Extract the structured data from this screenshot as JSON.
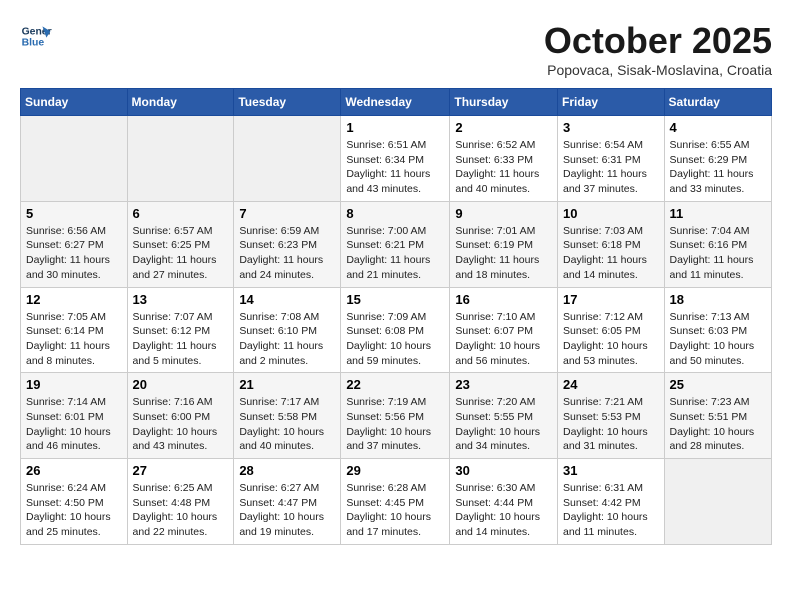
{
  "header": {
    "logo_line1": "General",
    "logo_line2": "Blue",
    "month": "October 2025",
    "location": "Popovaca, Sisak-Moslavina, Croatia"
  },
  "weekdays": [
    "Sunday",
    "Monday",
    "Tuesday",
    "Wednesday",
    "Thursday",
    "Friday",
    "Saturday"
  ],
  "weeks": [
    [
      {
        "day": "",
        "info": ""
      },
      {
        "day": "",
        "info": ""
      },
      {
        "day": "",
        "info": ""
      },
      {
        "day": "1",
        "info": "Sunrise: 6:51 AM\nSunset: 6:34 PM\nDaylight: 11 hours\nand 43 minutes."
      },
      {
        "day": "2",
        "info": "Sunrise: 6:52 AM\nSunset: 6:33 PM\nDaylight: 11 hours\nand 40 minutes."
      },
      {
        "day": "3",
        "info": "Sunrise: 6:54 AM\nSunset: 6:31 PM\nDaylight: 11 hours\nand 37 minutes."
      },
      {
        "day": "4",
        "info": "Sunrise: 6:55 AM\nSunset: 6:29 PM\nDaylight: 11 hours\nand 33 minutes."
      }
    ],
    [
      {
        "day": "5",
        "info": "Sunrise: 6:56 AM\nSunset: 6:27 PM\nDaylight: 11 hours\nand 30 minutes."
      },
      {
        "day": "6",
        "info": "Sunrise: 6:57 AM\nSunset: 6:25 PM\nDaylight: 11 hours\nand 27 minutes."
      },
      {
        "day": "7",
        "info": "Sunrise: 6:59 AM\nSunset: 6:23 PM\nDaylight: 11 hours\nand 24 minutes."
      },
      {
        "day": "8",
        "info": "Sunrise: 7:00 AM\nSunset: 6:21 PM\nDaylight: 11 hours\nand 21 minutes."
      },
      {
        "day": "9",
        "info": "Sunrise: 7:01 AM\nSunset: 6:19 PM\nDaylight: 11 hours\nand 18 minutes."
      },
      {
        "day": "10",
        "info": "Sunrise: 7:03 AM\nSunset: 6:18 PM\nDaylight: 11 hours\nand 14 minutes."
      },
      {
        "day": "11",
        "info": "Sunrise: 7:04 AM\nSunset: 6:16 PM\nDaylight: 11 hours\nand 11 minutes."
      }
    ],
    [
      {
        "day": "12",
        "info": "Sunrise: 7:05 AM\nSunset: 6:14 PM\nDaylight: 11 hours\nand 8 minutes."
      },
      {
        "day": "13",
        "info": "Sunrise: 7:07 AM\nSunset: 6:12 PM\nDaylight: 11 hours\nand 5 minutes."
      },
      {
        "day": "14",
        "info": "Sunrise: 7:08 AM\nSunset: 6:10 PM\nDaylight: 11 hours\nand 2 minutes."
      },
      {
        "day": "15",
        "info": "Sunrise: 7:09 AM\nSunset: 6:08 PM\nDaylight: 10 hours\nand 59 minutes."
      },
      {
        "day": "16",
        "info": "Sunrise: 7:10 AM\nSunset: 6:07 PM\nDaylight: 10 hours\nand 56 minutes."
      },
      {
        "day": "17",
        "info": "Sunrise: 7:12 AM\nSunset: 6:05 PM\nDaylight: 10 hours\nand 53 minutes."
      },
      {
        "day": "18",
        "info": "Sunrise: 7:13 AM\nSunset: 6:03 PM\nDaylight: 10 hours\nand 50 minutes."
      }
    ],
    [
      {
        "day": "19",
        "info": "Sunrise: 7:14 AM\nSunset: 6:01 PM\nDaylight: 10 hours\nand 46 minutes."
      },
      {
        "day": "20",
        "info": "Sunrise: 7:16 AM\nSunset: 6:00 PM\nDaylight: 10 hours\nand 43 minutes."
      },
      {
        "day": "21",
        "info": "Sunrise: 7:17 AM\nSunset: 5:58 PM\nDaylight: 10 hours\nand 40 minutes."
      },
      {
        "day": "22",
        "info": "Sunrise: 7:19 AM\nSunset: 5:56 PM\nDaylight: 10 hours\nand 37 minutes."
      },
      {
        "day": "23",
        "info": "Sunrise: 7:20 AM\nSunset: 5:55 PM\nDaylight: 10 hours\nand 34 minutes."
      },
      {
        "day": "24",
        "info": "Sunrise: 7:21 AM\nSunset: 5:53 PM\nDaylight: 10 hours\nand 31 minutes."
      },
      {
        "day": "25",
        "info": "Sunrise: 7:23 AM\nSunset: 5:51 PM\nDaylight: 10 hours\nand 28 minutes."
      }
    ],
    [
      {
        "day": "26",
        "info": "Sunrise: 6:24 AM\nSunset: 4:50 PM\nDaylight: 10 hours\nand 25 minutes."
      },
      {
        "day": "27",
        "info": "Sunrise: 6:25 AM\nSunset: 4:48 PM\nDaylight: 10 hours\nand 22 minutes."
      },
      {
        "day": "28",
        "info": "Sunrise: 6:27 AM\nSunset: 4:47 PM\nDaylight: 10 hours\nand 19 minutes."
      },
      {
        "day": "29",
        "info": "Sunrise: 6:28 AM\nSunset: 4:45 PM\nDaylight: 10 hours\nand 17 minutes."
      },
      {
        "day": "30",
        "info": "Sunrise: 6:30 AM\nSunset: 4:44 PM\nDaylight: 10 hours\nand 14 minutes."
      },
      {
        "day": "31",
        "info": "Sunrise: 6:31 AM\nSunset: 4:42 PM\nDaylight: 10 hours\nand 11 minutes."
      },
      {
        "day": "",
        "info": ""
      }
    ]
  ]
}
